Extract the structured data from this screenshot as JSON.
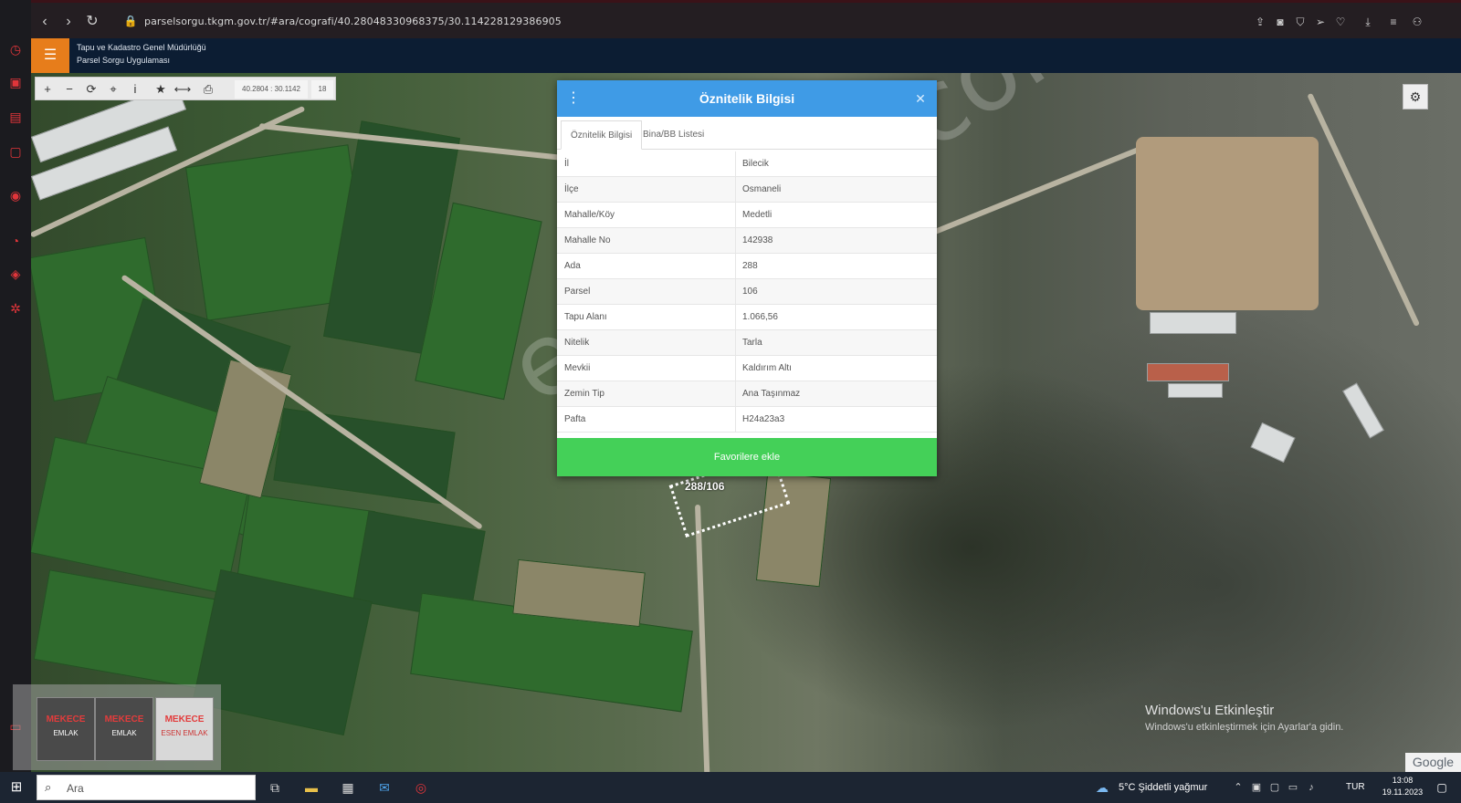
{
  "browser": {
    "url": "parselsorgu.tkgm.gov.tr/#ara/cografi/40.28048330968375/30.114228129386905",
    "icons": [
      "back-icon",
      "forward-icon",
      "reload-icon",
      "lock-icon",
      "share-icon",
      "camera-icon",
      "shield-icon",
      "send-icon",
      "heart-icon",
      "download-icon",
      "menu-icon",
      "profile-icon"
    ]
  },
  "app": {
    "org_line1": "Tapu ve Kadastro Genel Müdürlüğü",
    "org_line2": "Parsel Sorgu Uygulaması"
  },
  "map_toolbar": {
    "coords": "40.2804 : 30.1142",
    "zoom": "18"
  },
  "map": {
    "parcel_label": "288/106",
    "watermark": "emlakjet.com"
  },
  "dialog": {
    "title": "Öznitelik Bilgisi",
    "tabs": [
      {
        "label": "Öznitelik Bilgisi",
        "active": true
      },
      {
        "label": "Bina/BB Listesi",
        "active": false
      }
    ],
    "rows": [
      {
        "key": "İl",
        "value": "Bilecik"
      },
      {
        "key": "İlçe",
        "value": "Osmaneli"
      },
      {
        "key": "Mahalle/Köy",
        "value": "Medetli"
      },
      {
        "key": "Mahalle No",
        "value": "142938"
      },
      {
        "key": "Ada",
        "value": "288"
      },
      {
        "key": "Parsel",
        "value": "106"
      },
      {
        "key": "Tapu Alanı",
        "value": "1.066,56"
      },
      {
        "key": "Nitelik",
        "value": "Tarla"
      },
      {
        "key": "Mevkii",
        "value": "Kaldırım Altı"
      },
      {
        "key": "Zemin Tip",
        "value": "Ana Taşınmaz"
      },
      {
        "key": "Pafta",
        "value": "H24a23a3"
      }
    ],
    "favorite_button": "Favorilere ekle"
  },
  "logos": {
    "tile1_top": "MEKECE",
    "tile1_bottom": "EMLAK",
    "tile2_top": "MEKECE",
    "tile2_bottom": "EMLAK",
    "tile3_top": "MEKECE",
    "tile3_bottom": "ESEN EMLAK"
  },
  "windows_activation": {
    "line1": "Windows'u Etkinleştir",
    "line2": "Windows'u etkinleştirmek için Ayarlar'a gidin."
  },
  "google_label": "Google",
  "taskbar": {
    "search_placeholder": "Ara",
    "weather": "5°C  Şiddetli yağmur",
    "lang": "TUR",
    "time": "13:08",
    "date": "19.11.2023"
  },
  "colors": {
    "dialog_header": "#3f9be6",
    "favorite_button": "#44d058",
    "menu_button": "#e77d1b",
    "app_header": "#0c1d33"
  }
}
